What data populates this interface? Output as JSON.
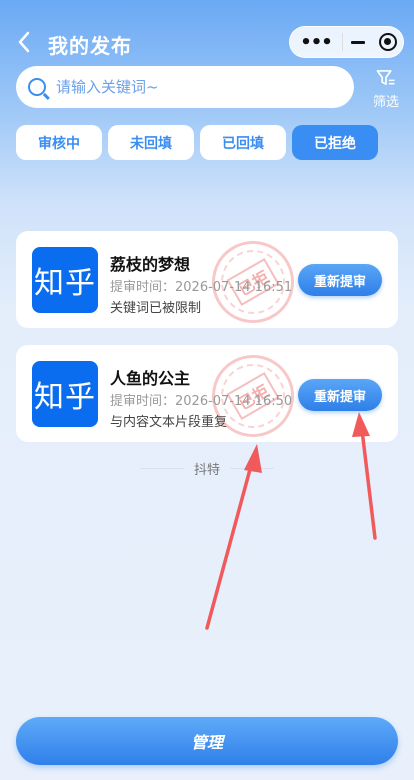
{
  "header": {
    "title": "我的发布",
    "back_icon": "chevron-left-icon",
    "capsule_more": "•••"
  },
  "search": {
    "placeholder": "请输入关键词~",
    "filter_label": "筛选"
  },
  "tabs": [
    {
      "label": "审核中",
      "active": false
    },
    {
      "label": "未回填",
      "active": false
    },
    {
      "label": "已回填",
      "active": false
    },
    {
      "label": "已拒绝",
      "active": true
    }
  ],
  "cards": [
    {
      "logo_text": "知乎",
      "title": "荔枝的梦想",
      "time": "提审时间：2026-07-14 16:51",
      "reason": "关键词已被限制",
      "button": "重新提审",
      "stamp": "已拒"
    },
    {
      "logo_text": "知乎",
      "title": "人鱼的公主",
      "time": "提审时间：2026-07-14 16:50",
      "reason": "与内容文本片段重复",
      "button": "重新提审",
      "stamp": "已拒"
    }
  ],
  "footer_divider": "抖特",
  "manage_label": "管理",
  "colors": {
    "accent": "#3a8ef3",
    "logo_bg": "#0a6df0",
    "arrow": "#f05a5a"
  }
}
